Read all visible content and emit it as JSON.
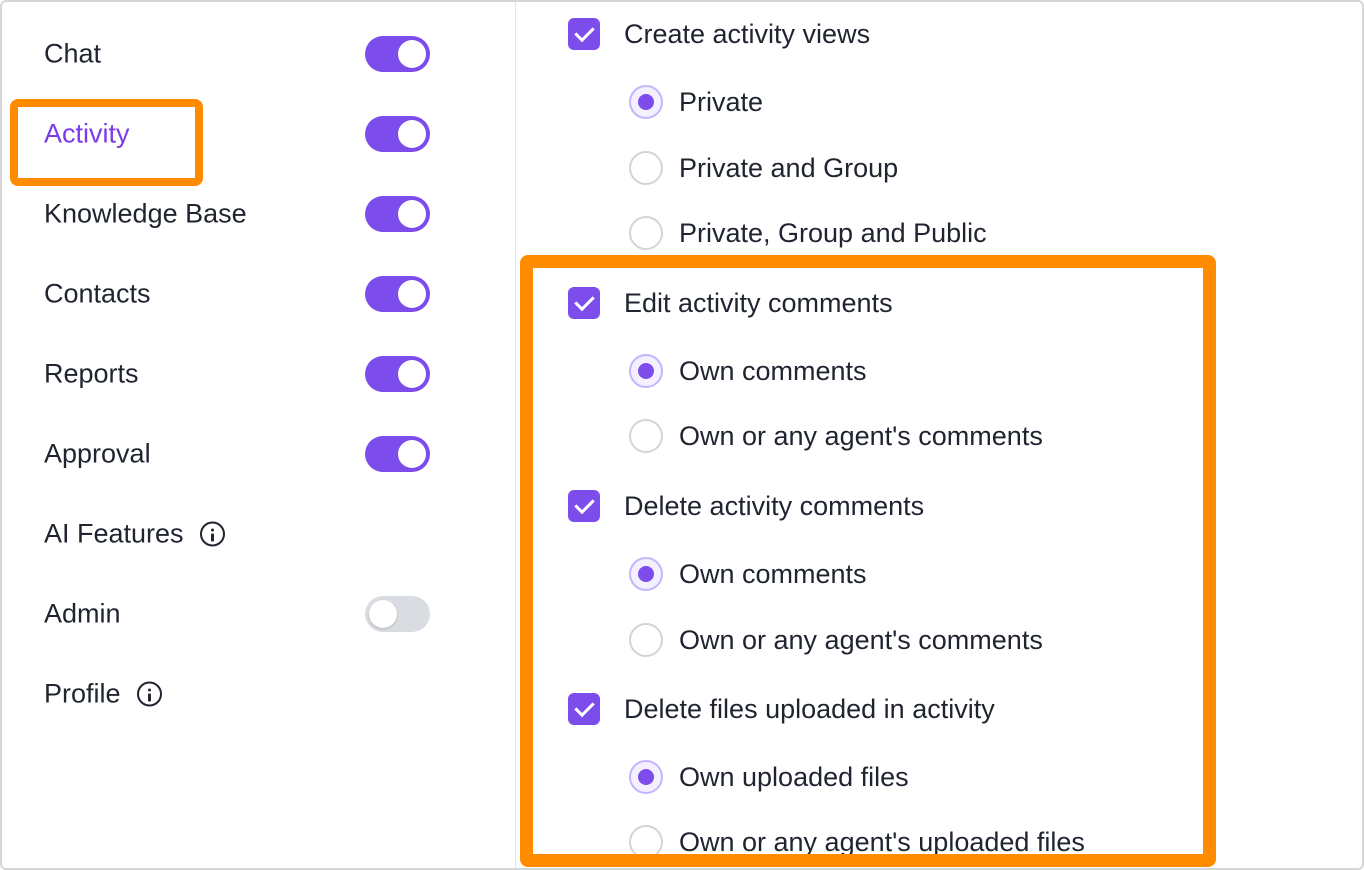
{
  "sidebar": {
    "modules": [
      {
        "label": "Chat",
        "toggle": "on",
        "info": false,
        "active": false
      },
      {
        "label": "Activity",
        "toggle": "on",
        "info": false,
        "active": true
      },
      {
        "label": "Knowledge Base",
        "toggle": "on",
        "info": false,
        "active": false
      },
      {
        "label": "Contacts",
        "toggle": "on",
        "info": false,
        "active": false
      },
      {
        "label": "Reports",
        "toggle": "on",
        "info": false,
        "active": false
      },
      {
        "label": "Approval",
        "toggle": "on",
        "info": false,
        "active": false
      },
      {
        "label": "AI Features",
        "toggle": "none",
        "info": true,
        "active": false
      },
      {
        "label": "Admin",
        "toggle": "off",
        "info": false,
        "active": false
      },
      {
        "label": "Profile",
        "toggle": "none",
        "info": true,
        "active": false
      }
    ]
  },
  "permissions": {
    "create_views": {
      "label": "Create activity views",
      "checked": true,
      "options": [
        {
          "label": "Private",
          "selected": true
        },
        {
          "label": "Private and Group",
          "selected": false
        },
        {
          "label": "Private, Group and Public",
          "selected": false
        }
      ]
    },
    "edit_comments": {
      "label": "Edit activity comments",
      "checked": true,
      "options": [
        {
          "label": "Own comments",
          "selected": true
        },
        {
          "label": "Own or any agent's comments",
          "selected": false
        }
      ]
    },
    "delete_comments": {
      "label": "Delete activity comments",
      "checked": true,
      "options": [
        {
          "label": "Own comments",
          "selected": true
        },
        {
          "label": "Own or any agent's comments",
          "selected": false
        }
      ]
    },
    "delete_files": {
      "label": "Delete files uploaded in activity",
      "checked": true,
      "options": [
        {
          "label": "Own uploaded files",
          "selected": true
        },
        {
          "label": "Own or any agent's uploaded files",
          "selected": false
        }
      ]
    }
  },
  "colors": {
    "accent": "#7c4dea",
    "highlight": "#ff8c00",
    "toggle_off": "#d9dde2"
  }
}
